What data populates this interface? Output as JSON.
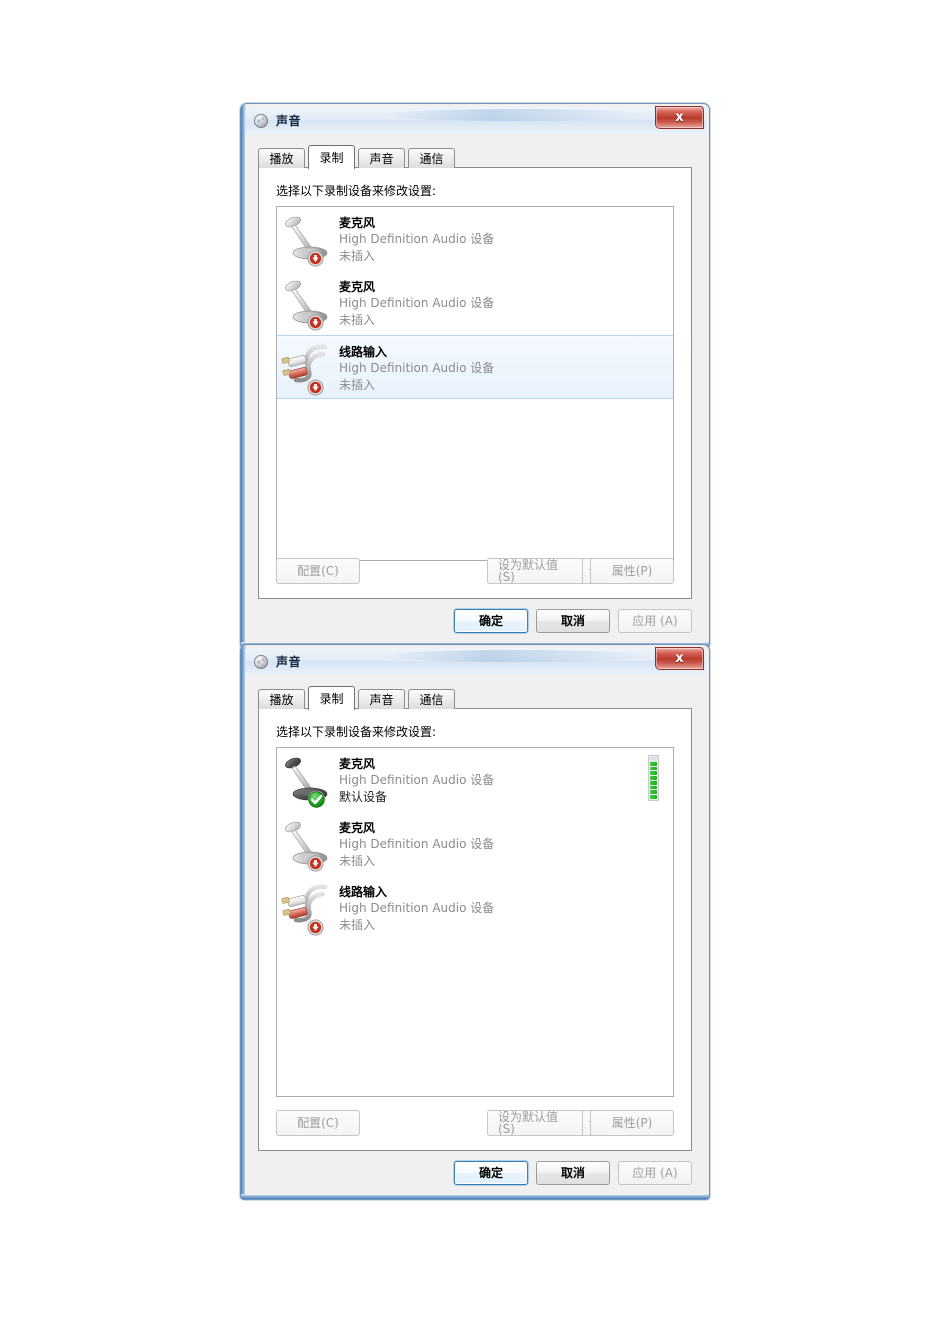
{
  "dialogs": [
    {
      "title": "声音",
      "icon": "speaker-icon",
      "close_label": "x",
      "tabs": [
        {
          "label": "播放",
          "active": false
        },
        {
          "label": "录制",
          "active": true
        },
        {
          "label": "声音",
          "active": false
        },
        {
          "label": "通信",
          "active": false
        }
      ],
      "panel_label": "选择以下录制设备来修改设置:",
      "devices": [
        {
          "icon": "microphone-icon",
          "badge": "down-arrow-badge",
          "name": "麦克风",
          "desc": "High Definition Audio 设备",
          "status": "未插入",
          "selected": false,
          "meter": null
        },
        {
          "icon": "microphone-icon",
          "badge": "down-arrow-badge",
          "name": "麦克风",
          "desc": "High Definition Audio 设备",
          "status": "未插入",
          "selected": false,
          "meter": null
        },
        {
          "icon": "line-in-icon",
          "badge": "down-arrow-badge",
          "name": "线路输入",
          "desc": "High Definition Audio 设备",
          "status": "未插入",
          "selected": true,
          "meter": null
        }
      ],
      "panel_buttons": {
        "configure": "配置(C)",
        "configure_key": "C",
        "set_default": "设为默认值(S)",
        "set_default_key": "S",
        "properties": "属性(P)",
        "properties_key": "P",
        "dropdown_icon": "chevron-down-icon"
      },
      "footer_buttons": {
        "ok": "确定",
        "cancel": "取消",
        "apply": "应用 (A)"
      }
    },
    {
      "title": "声音",
      "icon": "speaker-icon",
      "close_label": "x",
      "tabs": [
        {
          "label": "播放",
          "active": false
        },
        {
          "label": "录制",
          "active": true
        },
        {
          "label": "声音",
          "active": false
        },
        {
          "label": "通信",
          "active": false
        }
      ],
      "panel_label": "选择以下录制设备来修改设置:",
      "devices": [
        {
          "icon": "microphone-icon",
          "badge": "green-check-badge",
          "name": "麦克风",
          "desc": "High Definition Audio 设备",
          "status": "默认设备",
          "selected": false,
          "meter": {
            "segments": 9,
            "lit": 8,
            "color": "#2cbf2c"
          }
        },
        {
          "icon": "microphone-icon",
          "badge": "down-arrow-badge",
          "name": "麦克风",
          "desc": "High Definition Audio 设备",
          "status": "未插入",
          "selected": false,
          "meter": null
        },
        {
          "icon": "line-in-icon",
          "badge": "down-arrow-badge",
          "name": "线路输入",
          "desc": "High Definition Audio 设备",
          "status": "未插入",
          "selected": false,
          "meter": null
        }
      ],
      "panel_buttons": {
        "configure": "配置(C)",
        "configure_key": "C",
        "set_default": "设为默认值(S)",
        "set_default_key": "S",
        "properties": "属性(P)",
        "properties_key": "P",
        "dropdown_icon": "chevron-down-icon"
      },
      "footer_buttons": {
        "ok": "确定",
        "cancel": "取消",
        "apply": "应用 (A)"
      }
    }
  ],
  "colors": {
    "accent": "#3c7fb1",
    "close_red": "#b93a2b",
    "meter_green": "#2cbf2c",
    "selected_row": "#e8f2fc",
    "muted_text": "#8c8c8c"
  }
}
